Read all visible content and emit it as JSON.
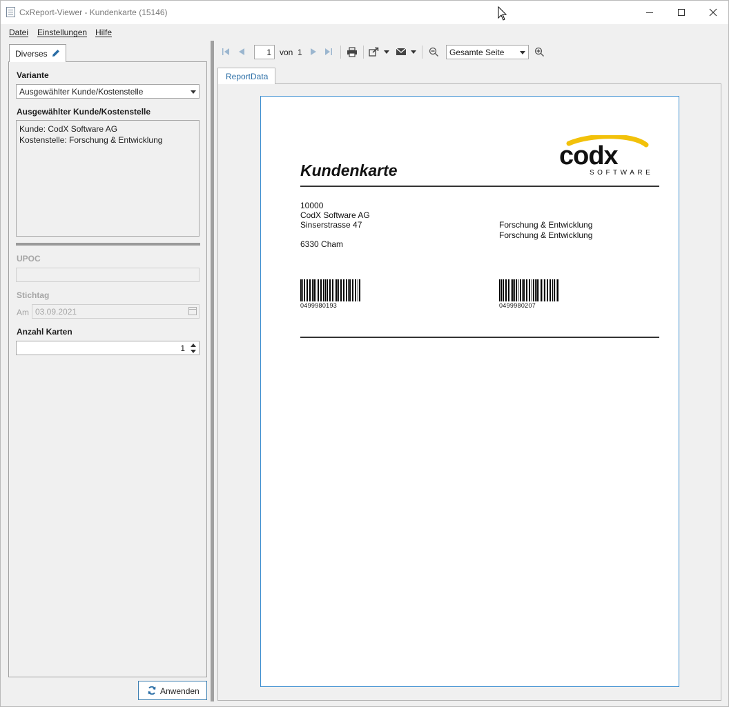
{
  "window": {
    "title": "CxReport-Viewer - Kundenkarte (15146)"
  },
  "menu": {
    "items": [
      "Datei",
      "Einstellungen",
      "Hilfe"
    ]
  },
  "left_panel": {
    "tab_label": "Diverses",
    "variante_label": "Variante",
    "variante_value": "Ausgewählter Kunde/Kostenstelle",
    "selection_label": "Ausgewählter Kunde/Kostenstelle",
    "selection_lines": [
      "Kunde: CodX Software AG",
      "Kostenstelle: Forschung & Entwicklung"
    ],
    "upoc_label": "UPOC",
    "upoc_value": "",
    "stichtag_label": "Stichtag",
    "am_label": "Am",
    "date_value": "03.09.2021",
    "anzahl_label": "Anzahl Karten",
    "anzahl_value": "1",
    "apply_label": "Anwenden"
  },
  "toolbar": {
    "page_value": "1",
    "von_label": "von",
    "page_total": "1",
    "zoom_value": "Gesamte Seite"
  },
  "report": {
    "tab_label": "ReportData",
    "title": "Kundenkarte",
    "logo_text": "codx",
    "logo_sub": "SOFTWARE",
    "address": {
      "number": "10000",
      "company": "CodX Software AG",
      "street": "Sinserstrasse 47",
      "city": "6330 Cham"
    },
    "cost_center": [
      "Forschung & Entwicklung",
      "Forschung & Entwicklung"
    ],
    "barcodes": [
      "0499980193",
      "0499980207"
    ]
  },
  "colors": {
    "accent": "#3c8ed0",
    "logo_yellow": "#f2c10a",
    "tab_text": "#2b6ea6"
  }
}
